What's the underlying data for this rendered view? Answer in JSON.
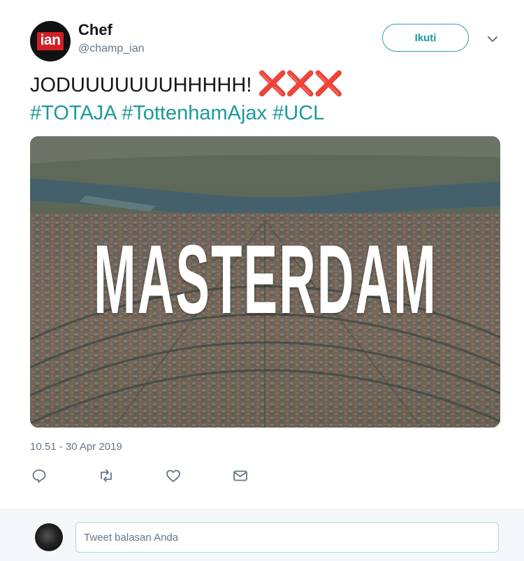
{
  "author": {
    "avatar_text": "ian",
    "name": "Chef",
    "handle": "@champ_ian"
  },
  "follow_label": "Ikuti",
  "tweet": {
    "text": "JODUUUUUUUHHHHH!",
    "emoji": "❌❌❌",
    "hashtags": [
      "#TOTAJA",
      "#TottenhamAjax",
      "#UCL"
    ]
  },
  "media": {
    "overlay_text": "MASTERDAM",
    "icon": "aerial-city-photo"
  },
  "timestamp": "10.51 - 30 Apr 2019",
  "actions": [
    "reply-icon",
    "retweet-icon",
    "like-icon",
    "message-icon"
  ],
  "reply": {
    "placeholder": "Tweet balasan Anda"
  },
  "colors": {
    "accent": "#1b9a9a",
    "muted": "#657786",
    "emoji_red": "#e0202a"
  }
}
